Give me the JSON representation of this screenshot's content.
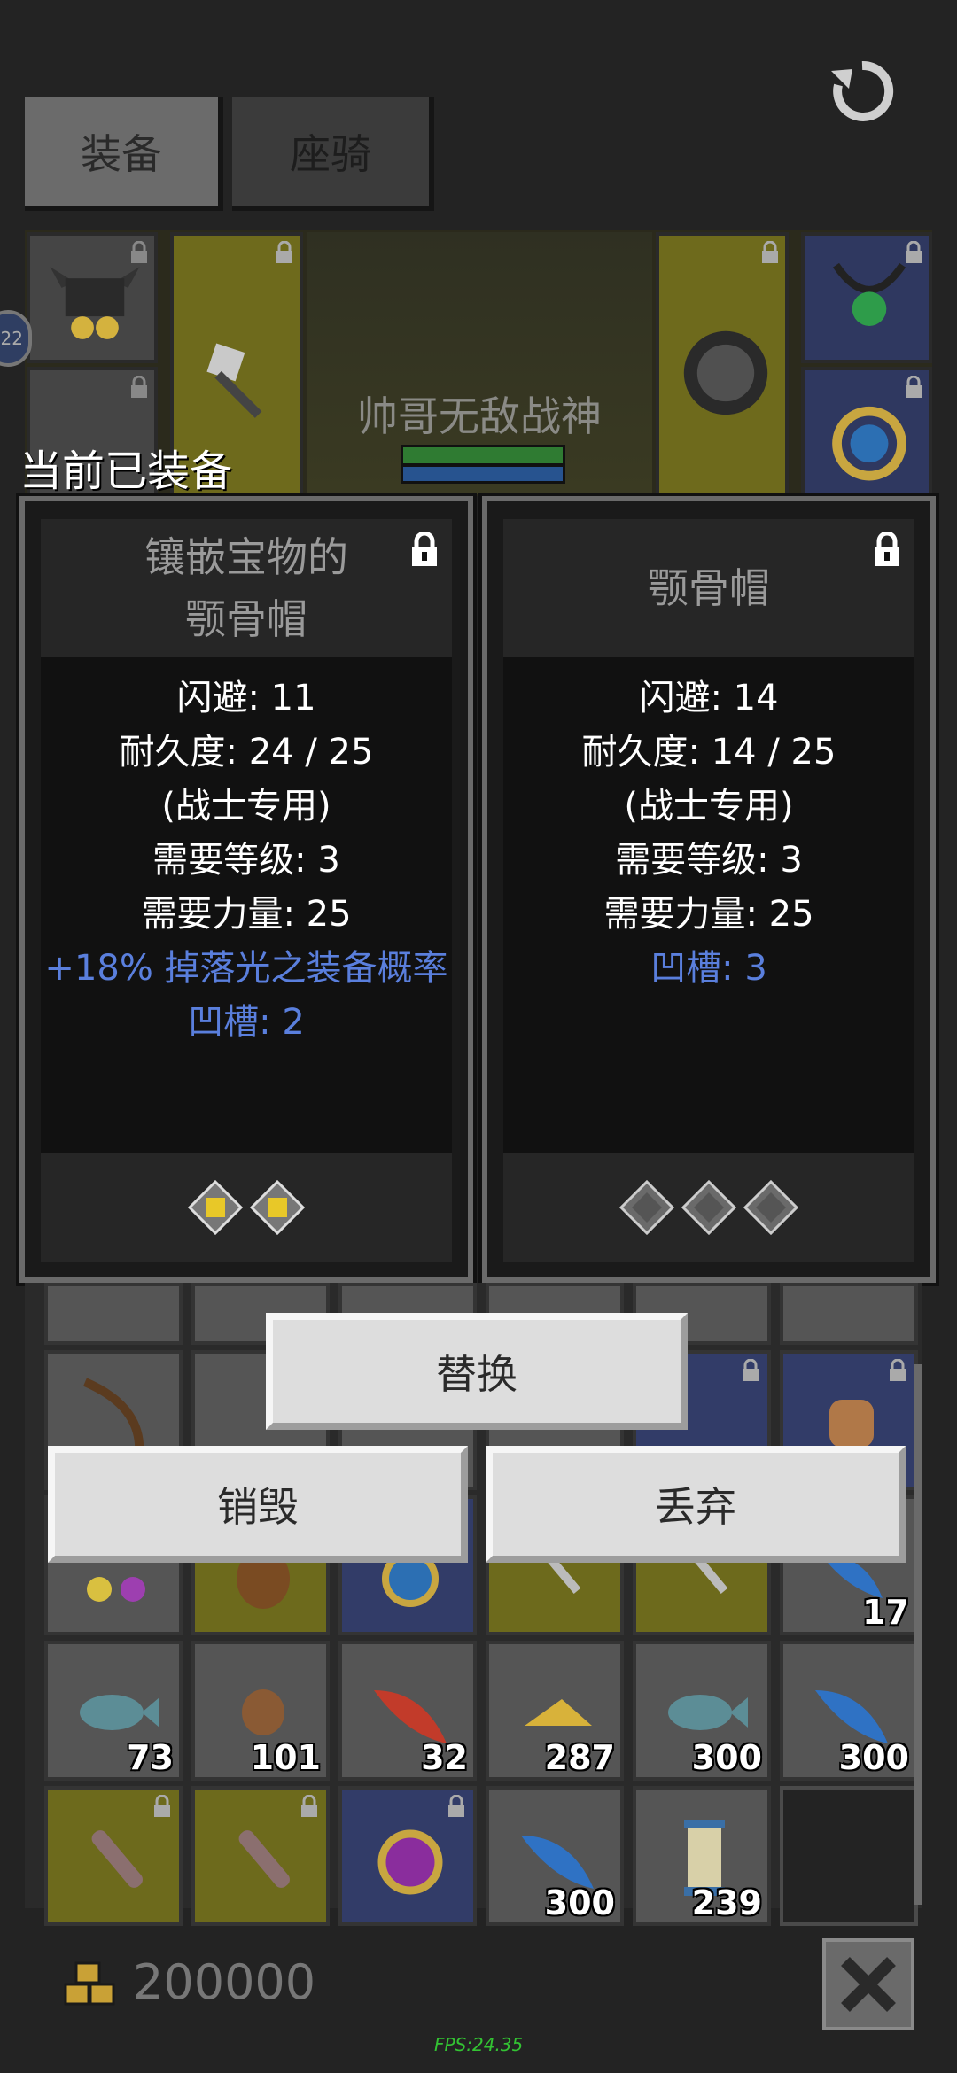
{
  "tabs": {
    "equipment": "装备",
    "mount": "座骑"
  },
  "hero": {
    "name": "帅哥无敌战神",
    "level_badge": "22"
  },
  "equipped_label": "当前已装备",
  "compare": [
    {
      "title_line1": "镶嵌宝物的",
      "title_line2": "颚骨帽",
      "stats": [
        "闪避: 11",
        "耐久度: 24 / 25",
        "(战士专用)",
        "需要等级: 3",
        "需要力量: 25"
      ],
      "bonus": [
        "+18% 掉落光之装备概率",
        "凹槽: 2"
      ],
      "sockets": [
        "gem-yellow",
        "gem-yellow"
      ]
    },
    {
      "title_line1": "",
      "title_line2": "颚骨帽",
      "stats": [
        "闪避: 14",
        "耐久度: 14 / 25",
        "(战士专用)",
        "需要等级: 3",
        "需要力量: 25"
      ],
      "bonus": [
        "凹槽: 3"
      ],
      "sockets": [
        "empty",
        "empty",
        "empty"
      ]
    }
  ],
  "actions": {
    "replace": "替换",
    "destroy": "销毁",
    "discard": "丢弃"
  },
  "inventory_counts": {
    "r3c6": "17",
    "r4": [
      "73",
      "101",
      "32",
      "287",
      "300",
      "300"
    ],
    "r5": [
      "",
      "",
      "",
      "300",
      "239",
      ""
    ]
  },
  "gold": "200000",
  "fps": "FPS:24.35",
  "colors": {
    "accent_blue": "#5a7fdd",
    "rare_yellow": "#6d6a1c",
    "magic_blue": "#323c68"
  }
}
